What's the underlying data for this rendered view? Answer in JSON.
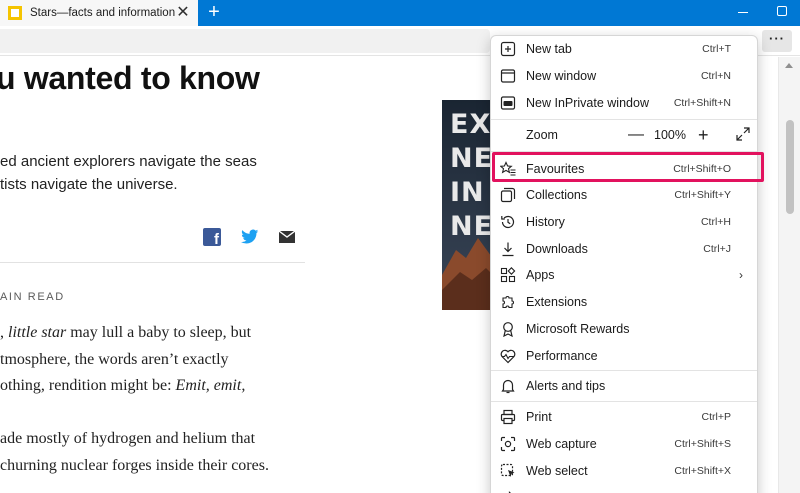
{
  "browser": {
    "tab_title": "Stars—facts and information",
    "tab_close_glyph": "✕",
    "new_tab_glyph": "+",
    "more_glyph": "···"
  },
  "article": {
    "headline": "u wanted to know",
    "subhead_lines": [
      "ed ancient explorers navigate the seas",
      "tists navigate the universe."
    ],
    "read_label": "AIN READ",
    "body_lines": [
      ", little star may lull a baby to sleep, but",
      "tmosphere, the words aren’t exactly",
      "othing, rendition might be: Emit, emit,",
      "",
      "ade mostly of hydrogen and helium that",
      "churning nuclear forges inside their cores."
    ],
    "ad_text": "EXP\nNEV\nIN A\nNEW"
  },
  "menu": {
    "new_tab": {
      "label": "New tab",
      "shortcut": "Ctrl+T",
      "icon": "new-tab-icon"
    },
    "new_window": {
      "label": "New window",
      "shortcut": "Ctrl+N",
      "icon": "new-window-icon"
    },
    "new_inprivate": {
      "label": "New InPrivate window",
      "shortcut": "Ctrl+Shift+N",
      "icon": "inprivate-icon"
    },
    "zoom": {
      "label": "Zoom",
      "minus": "—",
      "value": "100%",
      "plus": "+",
      "icon": "fullscreen-icon"
    },
    "favourites": {
      "label": "Favourites",
      "shortcut": "Ctrl+Shift+O",
      "icon": "favourites-icon"
    },
    "collections": {
      "label": "Collections",
      "shortcut": "Ctrl+Shift+Y",
      "icon": "collections-icon"
    },
    "history": {
      "label": "History",
      "shortcut": "Ctrl+H",
      "icon": "history-icon"
    },
    "downloads": {
      "label": "Downloads",
      "shortcut": "Ctrl+J",
      "icon": "download-icon"
    },
    "apps": {
      "label": "Apps",
      "chevron": "›",
      "icon": "apps-icon"
    },
    "extensions": {
      "label": "Extensions",
      "icon": "extensions-icon"
    },
    "rewards": {
      "label": "Microsoft Rewards",
      "icon": "rewards-icon"
    },
    "performance": {
      "label": "Performance",
      "icon": "performance-icon"
    },
    "alerts": {
      "label": "Alerts and tips",
      "icon": "bell-icon"
    },
    "print": {
      "label": "Print",
      "shortcut": "Ctrl+P",
      "icon": "printer-icon"
    },
    "web_capture": {
      "label": "Web capture",
      "shortcut": "Ctrl+Shift+S",
      "icon": "web-capture-icon"
    },
    "web_select": {
      "label": "Web select",
      "shortcut": "Ctrl+Shift+X",
      "icon": "web-select-icon"
    }
  },
  "colors": {
    "titlebar": "#0078d4",
    "highlight": "#e2125e",
    "facebook": "#3b5998",
    "twitter": "#1da1f2"
  }
}
